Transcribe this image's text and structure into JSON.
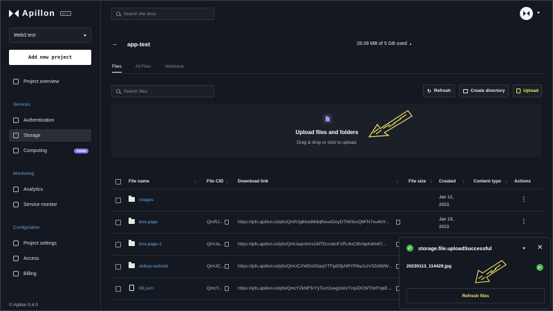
{
  "brand": {
    "name": "Apillon",
    "badge": "BETA"
  },
  "sidebar": {
    "project": "Web3 test",
    "new_project": "Add new project",
    "overview": "Project overview",
    "sections": {
      "services": "Services",
      "monitoring": "Monitoring",
      "configuration": "Configuration"
    },
    "items": {
      "authentication": "Authentication",
      "storage": "Storage",
      "computing": "Computing",
      "computing_badge": "SOON",
      "analytics": "Analytics",
      "service_monitor": "Service monitor",
      "project_settings": "Project settings",
      "access": "Access",
      "billing": "Billing"
    },
    "version": "© Apillon 0.4.0"
  },
  "topbar": {
    "search_placeholder": "Search the docs"
  },
  "bucket": {
    "title": "app-test",
    "usage": "28.09 MB of 5 GB used",
    "tabs": [
      "Files",
      "All Files",
      "Webhook"
    ],
    "active_tab": "Files",
    "search_placeholder": "Search files",
    "refresh": "Refresh",
    "create_directory": "Create directory",
    "upload": "Upload"
  },
  "dropzone": {
    "title": "Upload files and folders",
    "subtitle": "Drag & drop or click to upload."
  },
  "table": {
    "headers": {
      "name": "File name",
      "cid": "File CID",
      "link": "Download link",
      "size": "File size",
      "created": "Created",
      "type": "Content type",
      "actions": "Actions"
    },
    "rows": [
      {
        "kind": "folder",
        "name": "images",
        "cid": "",
        "link": "",
        "created_1": "Jan 12,",
        "created_2": "2023"
      },
      {
        "kind": "folder",
        "name": "test-page",
        "cid": "QmRJ...",
        "link": "https://ipfs.apillon.io/ipfs/QmRJg6totdMdqfheveDoyDTtW3xvQ6FN7xu4trX...",
        "created_1": "Jan 13,",
        "created_2": "2023"
      },
      {
        "kind": "folder",
        "name": "test-page-2",
        "cid": "QmUa...",
        "link": "https://ipfs.apillon.io/ipfs/QmUaqnXms1MTEccsbnFzPL4uC8hntpKdim67...",
        "created_1": "",
        "created_2": ""
      },
      {
        "kind": "folder",
        "name": "skillup-website",
        "cid": "QmUC...",
        "link": "https://ipfs.apillon.io/ipfs/QmUCXWDs5SasjYTFjaf2fpNRYP8aJs1VSDdWW...",
        "created_1": "",
        "created_2": ""
      },
      {
        "kind": "file",
        "name": "98.json",
        "cid": "QmcY...",
        "link": "https://ipfs.apillon.io/ipfs/QmcYZkNF5rYyTurz2xeg2oKzTrxjvDCWTNrFnpiE...",
        "created_1": "",
        "created_2": ""
      }
    ]
  },
  "toast": {
    "title": "storage.file.uploadSuccessful",
    "file": "20230113_114429.jpg",
    "refresh": "Refresh files"
  },
  "colors": {
    "accent_yellow": "#f5e663",
    "link_blue": "#5fa8e8",
    "success_green": "#4fb84f",
    "badge_purple": "#8a7bf0"
  }
}
